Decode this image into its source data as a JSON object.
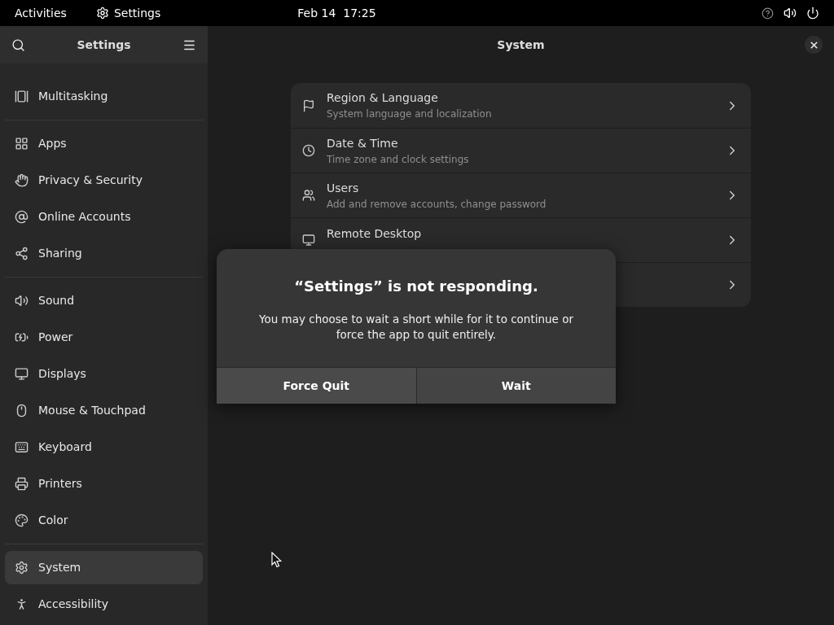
{
  "top_bar": {
    "activities": "Activities",
    "app_name": "Settings",
    "clock": "Feb 14  17:25"
  },
  "sidebar": {
    "title": "Settings",
    "groups": [
      [
        {
          "label": "Multitasking",
          "selected": false
        }
      ],
      [
        {
          "label": "Apps",
          "selected": false
        },
        {
          "label": "Privacy & Security",
          "selected": false
        },
        {
          "label": "Online Accounts",
          "selected": false
        },
        {
          "label": "Sharing",
          "selected": false
        }
      ],
      [
        {
          "label": "Sound",
          "selected": false
        },
        {
          "label": "Power",
          "selected": false
        },
        {
          "label": "Displays",
          "selected": false
        },
        {
          "label": "Mouse & Touchpad",
          "selected": false
        },
        {
          "label": "Keyboard",
          "selected": false
        },
        {
          "label": "Printers",
          "selected": false
        },
        {
          "label": "Color",
          "selected": false
        }
      ],
      [
        {
          "label": "System",
          "selected": true
        },
        {
          "label": "Accessibility",
          "selected": false
        }
      ]
    ]
  },
  "main": {
    "title": "System",
    "rows": [
      {
        "title": "Region & Language",
        "subtitle": "System language and localization"
      },
      {
        "title": "Date & Time",
        "subtitle": "Time zone and clock settings"
      },
      {
        "title": "Users",
        "subtitle": "Add and remove accounts, change password"
      },
      {
        "title": "Remote Desktop"
      },
      {}
    ]
  },
  "dialog": {
    "title": "“Settings” is not responding.",
    "message": "You may choose to wait a short while for it to continue or force the app to quit entirely.",
    "buttons": [
      "Force Quit",
      "Wait"
    ]
  }
}
